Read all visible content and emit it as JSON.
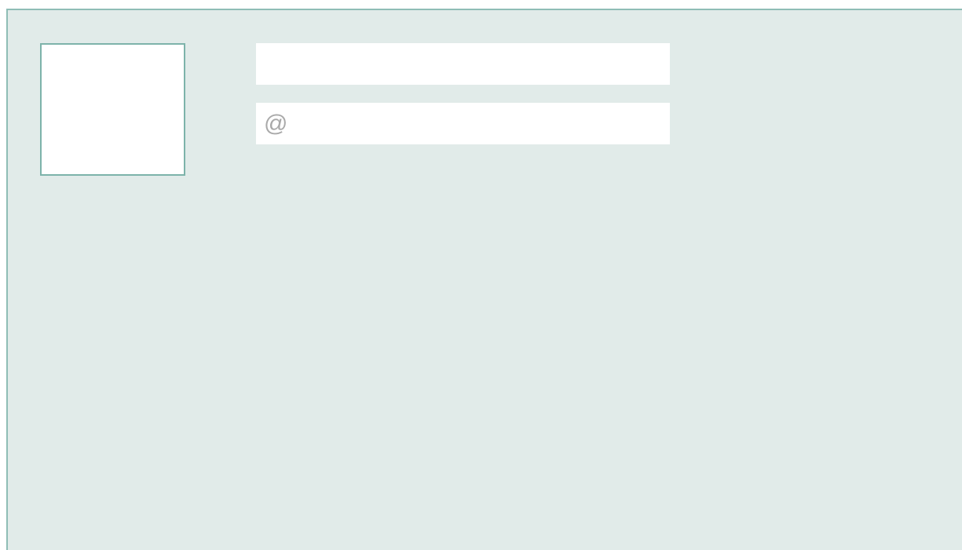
{
  "profile_form": {
    "name_field": {
      "value": "",
      "placeholder": ""
    },
    "handle_field": {
      "value": "",
      "placeholder": "@"
    }
  },
  "colors": {
    "panel_background": "#e1ebe9",
    "panel_border": "#8fbdb6",
    "avatar_border": "#7db3aa",
    "field_background": "#ffffff",
    "placeholder_text": "#a9a9a9"
  },
  "icons": {
    "avatar": "avatar-placeholder"
  }
}
